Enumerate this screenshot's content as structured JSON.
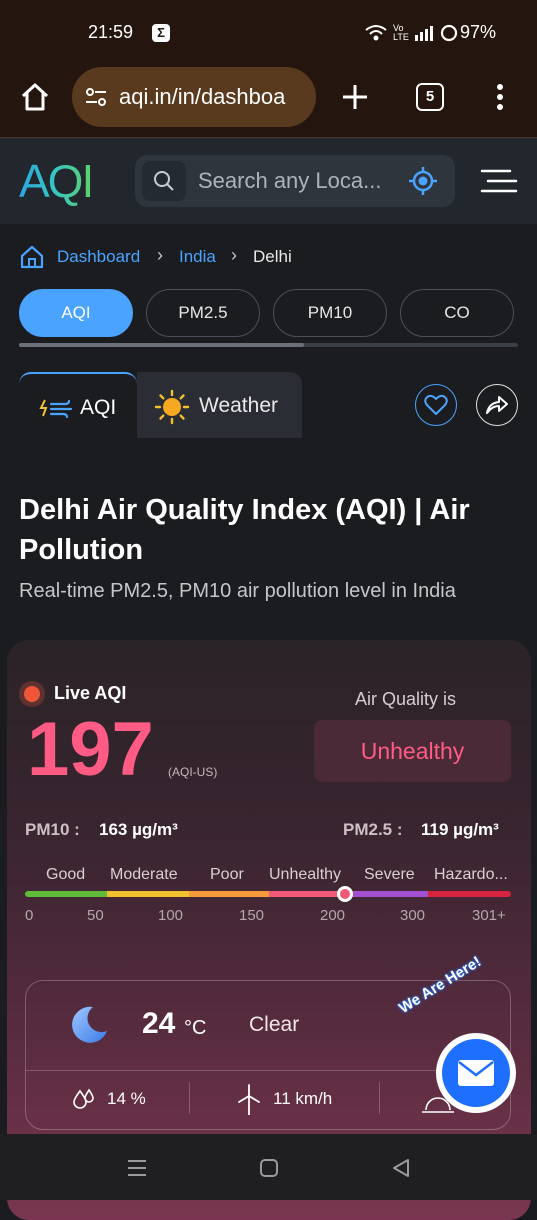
{
  "status_bar": {
    "time": "21:59",
    "battery": "97%"
  },
  "browser": {
    "url": "aqi.in/in/dashboa",
    "tab_count": "5"
  },
  "header": {
    "logo_text": "AQI",
    "search_placeholder": "Search any Loca..."
  },
  "breadcrumb": {
    "items": [
      "Dashboard",
      "India",
      "Delhi"
    ]
  },
  "pollutant_tabs": {
    "items": [
      "AQI",
      "PM2.5",
      "PM10",
      "CO"
    ],
    "active": "AQI"
  },
  "view_tabs": {
    "aqi": "AQI",
    "weather": "Weather"
  },
  "page": {
    "title_line1": "Delhi Air Quality Index (AQI) | Air",
    "title_line2": "Pollution",
    "subtitle": "Real-time PM2.5, PM10 air pollution level in India"
  },
  "aqi_card": {
    "live_label": "Live AQI",
    "value": "197",
    "unit": "(AQI-US)",
    "air_quality_label": "Air Quality is",
    "status": "Unhealthy",
    "pm10_label": "PM10 :",
    "pm10_value": "163 µg/m³",
    "pm25_label": "PM2.5 :",
    "pm25_value": "119 µg/m³",
    "scale_labels": [
      "Good",
      "Moderate",
      "Poor",
      "Unhealthy",
      "Severe",
      "Hazardo..."
    ],
    "scale_numbers": [
      "0",
      "50",
      "100",
      "150",
      "200",
      "300",
      "301+"
    ],
    "scale_marker_value": 197
  },
  "weather": {
    "temperature": "24",
    "temp_unit": "°C",
    "condition": "Clear",
    "humidity": "14 %",
    "wind": "11 km/h"
  },
  "fab": {
    "badge_text": "We Are Here!"
  },
  "colors": {
    "accent": "#4aa3ff",
    "aqi_value": "#ff5b84",
    "good": "#5fbb3a",
    "moderate": "#f2c22e",
    "poor": "#f39a3a",
    "unhealthy": "#f05a78",
    "severe": "#a24fd0",
    "hazardous": "#d8233f"
  }
}
